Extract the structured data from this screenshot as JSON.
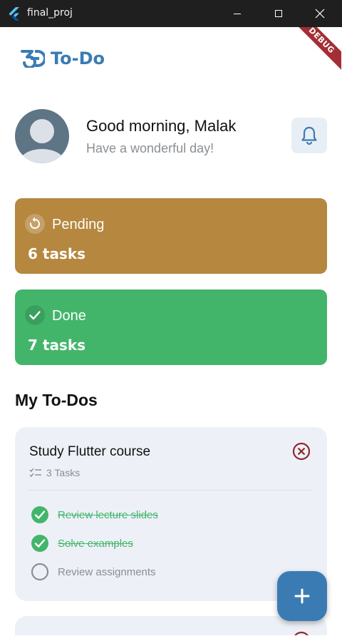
{
  "window": {
    "title": "final_proj",
    "controls": [
      "minimize",
      "maximize",
      "close"
    ]
  },
  "app": {
    "logo_text": "To-Do",
    "debug_banner": "DEBUG"
  },
  "header": {
    "greeting": "Good morning, Malak",
    "subtitle": "Have a wonderful day!",
    "notification_icon": "bell-icon"
  },
  "stats": {
    "pending": {
      "label": "Pending",
      "count": "6 tasks",
      "color": "#b5873f",
      "icon": "refresh-icon"
    },
    "done": {
      "label": "Done",
      "count": "7 tasks",
      "color": "#43b56b",
      "icon": "check-icon"
    }
  },
  "todos": {
    "section_title": "My To-Dos",
    "items": [
      {
        "title": "Study Flutter course",
        "task_count": "3 Tasks",
        "subtasks": [
          {
            "label": "Review lecture slides",
            "done": true
          },
          {
            "label": "Solve examples",
            "done": true
          },
          {
            "label": "Review assignments",
            "done": false
          }
        ]
      }
    ]
  },
  "colors": {
    "accent": "#3b7bb3",
    "done": "#43b56b",
    "pending": "#b5873f",
    "remove": "#8e2a2f",
    "card_bg": "#edf1f7"
  },
  "fab": {
    "icon": "plus-icon"
  }
}
